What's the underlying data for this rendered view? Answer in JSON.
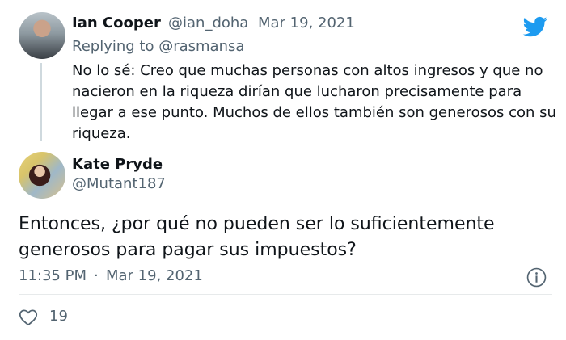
{
  "tweet_quoted": {
    "name": "Ian Cooper",
    "handle": "@ian_doha",
    "separator": "·",
    "date": "Mar 19, 2021",
    "replying_prefix": "Replying to",
    "replying_handle": "@rasmansa",
    "text": "No lo sé: Creo que muchas personas con altos ingresos y que no nacieron en la riqueza dirían que lucharon precisamente para llegar a ese punto. Muchos de ellos también son generosos con su riqueza."
  },
  "tweet_main": {
    "name": "Kate Pryde",
    "handle": "@Mutant187",
    "text": "Entonces, ¿por qué no pueden ser lo suficientemente generosos para pagar sus impuestos?",
    "time": "11:35 PM",
    "separator": "·",
    "date": "Mar 19, 2021",
    "likes": "19"
  },
  "colors": {
    "twitter_blue": "#1d9bf0",
    "muted": "#536471",
    "text": "#0f1419",
    "divider": "#e7eaeb"
  },
  "icons": [
    "twitter-bird-icon",
    "info-icon",
    "heart-icon"
  ]
}
